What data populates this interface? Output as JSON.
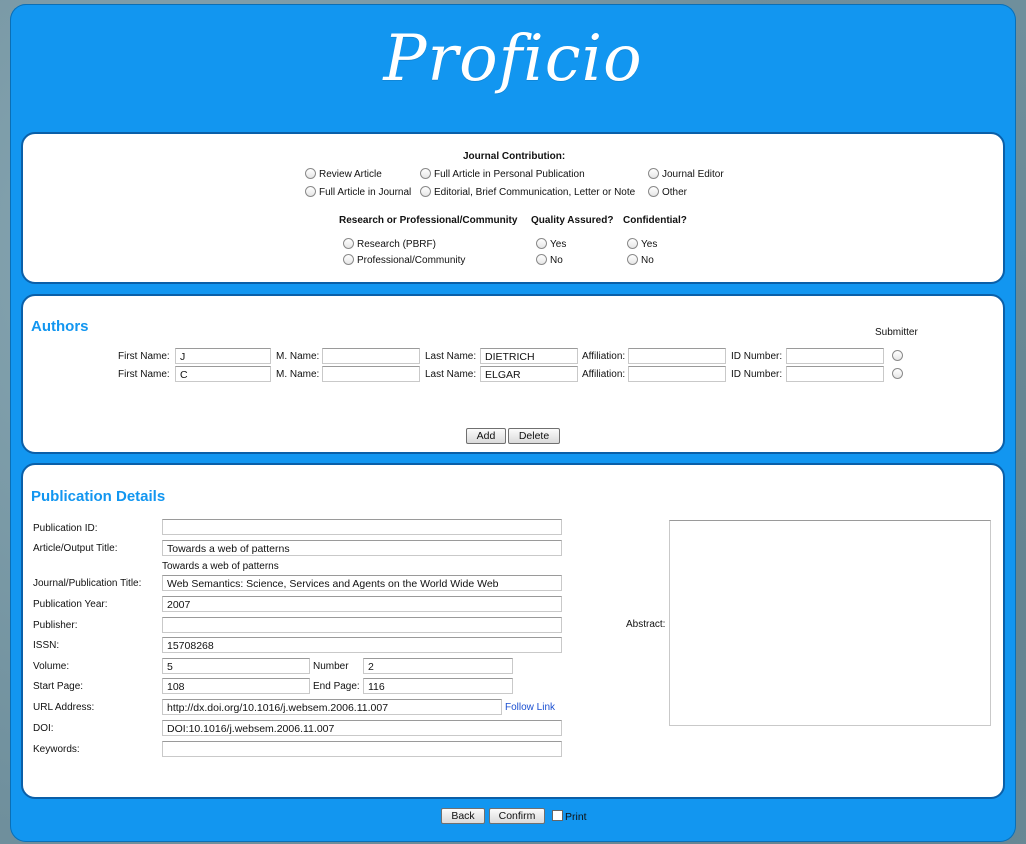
{
  "logo": "Proficio",
  "contribution": {
    "title": "Journal Contribution:",
    "options": [
      "Review Article",
      "Full Article in Personal Publication",
      "Journal Editor",
      "Full Article in Journal",
      "Editorial, Brief Communication, Letter or Note",
      "Other"
    ],
    "research_title": "Research or Professional/Community",
    "research_options": [
      "Research (PBRF)",
      "Professional/Community"
    ],
    "quality_title": "Quality Assured?",
    "quality_options": [
      "Yes",
      "No"
    ],
    "confidential_title": "Confidential?",
    "confidential_options": [
      "Yes",
      "No"
    ]
  },
  "authors": {
    "title": "Authors",
    "submitter_label": "Submitter",
    "labels": {
      "first": "First Name:",
      "middle": "M. Name:",
      "last": "Last Name:",
      "affiliation": "Affiliation:",
      "id": "ID Number:"
    },
    "rows": [
      {
        "first": "J",
        "middle": "",
        "last": "DIETRICH",
        "affiliation": "",
        "id": ""
      },
      {
        "first": "C",
        "middle": "",
        "last": "ELGAR",
        "affiliation": "",
        "id": ""
      }
    ],
    "add_label": "Add",
    "delete_label": "Delete"
  },
  "publication": {
    "title": "Publication Details",
    "labels": {
      "pub_id": "Publication ID:",
      "article_title": "Article/Output Title:",
      "journal_title": "Journal/Publication Title:",
      "year": "Publication Year:",
      "publisher": "Publisher:",
      "issn": "ISSN:",
      "volume": "Volume:",
      "number": "Number",
      "start_page": "Start Page:",
      "end_page": "End Page:",
      "url": "URL Address:",
      "doi": "DOI:",
      "keywords": "Keywords:",
      "abstract": "Abstract:"
    },
    "values": {
      "pub_id": "",
      "article_title": "Towards a web of patterns",
      "article_title_echo": "Towards a web of patterns",
      "journal_title": "Web Semantics: Science, Services and Agents on the World Wide Web",
      "year": "2007",
      "publisher": "",
      "issn": "15708268",
      "volume": "5",
      "number": "2",
      "start_page": "108",
      "end_page": "116",
      "url": "http://dx.doi.org/10.1016/j.websem.2006.11.007",
      "doi": "DOI:10.1016/j.websem.2006.11.007",
      "keywords": ""
    },
    "follow_link": "Follow Link"
  },
  "footer": {
    "back_label": "Back",
    "confirm_label": "Confirm",
    "print_label": "Print"
  }
}
